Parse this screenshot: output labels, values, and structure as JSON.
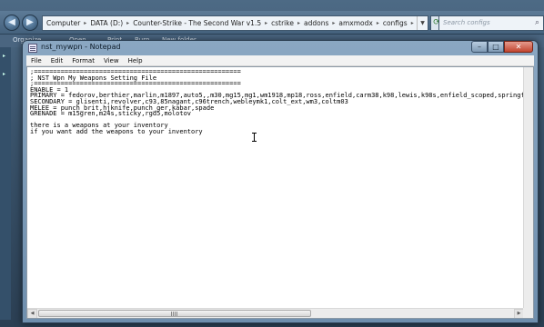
{
  "explorer": {
    "breadcrumb": [
      "Computer",
      "DATA (D:)",
      "Counter-Strike - The Second War v1.5",
      "cstrike",
      "addons",
      "amxmodx",
      "configs"
    ],
    "search_placeholder": "Search configs",
    "toolbar": [
      "Organize",
      "Open",
      "Print",
      "Burn",
      "New folder"
    ]
  },
  "notepad": {
    "title": "nst_mywpn - Notepad",
    "window_buttons": {
      "minimize": "–",
      "maximize": "□",
      "close": "✕"
    },
    "menu": [
      "File",
      "Edit",
      "Format",
      "View",
      "Help"
    ],
    "content": ";======================================================\n; NST Wpn My Weapons Setting File\n;======================================================\nENABLE = 1\nPRIMARY = fedorov,berthier,marlin,m1897,auto5,,m30,mg15,mg1,wm1918,mp18,ross,enfield,carm38,k98,lewis,k98s,enfield_scoped,springfield\nSECONDARY = glisenti,revolver,c93,85nagant,c96trench,webleymk1,colt_ext,wm3,coltm03\nMELEE = punch_brit,hjknife,punch_ger,kabar,spade\nGRENADE = m15gren,m24s,sticky,rgd5,molotov\n\nthere is a weapons at your inventory\nif you want add the weapons to your inventory"
  },
  "icons": [
    "back-icon",
    "forward-icon",
    "refresh-icon",
    "search-icon",
    "notepad-app-icon"
  ]
}
